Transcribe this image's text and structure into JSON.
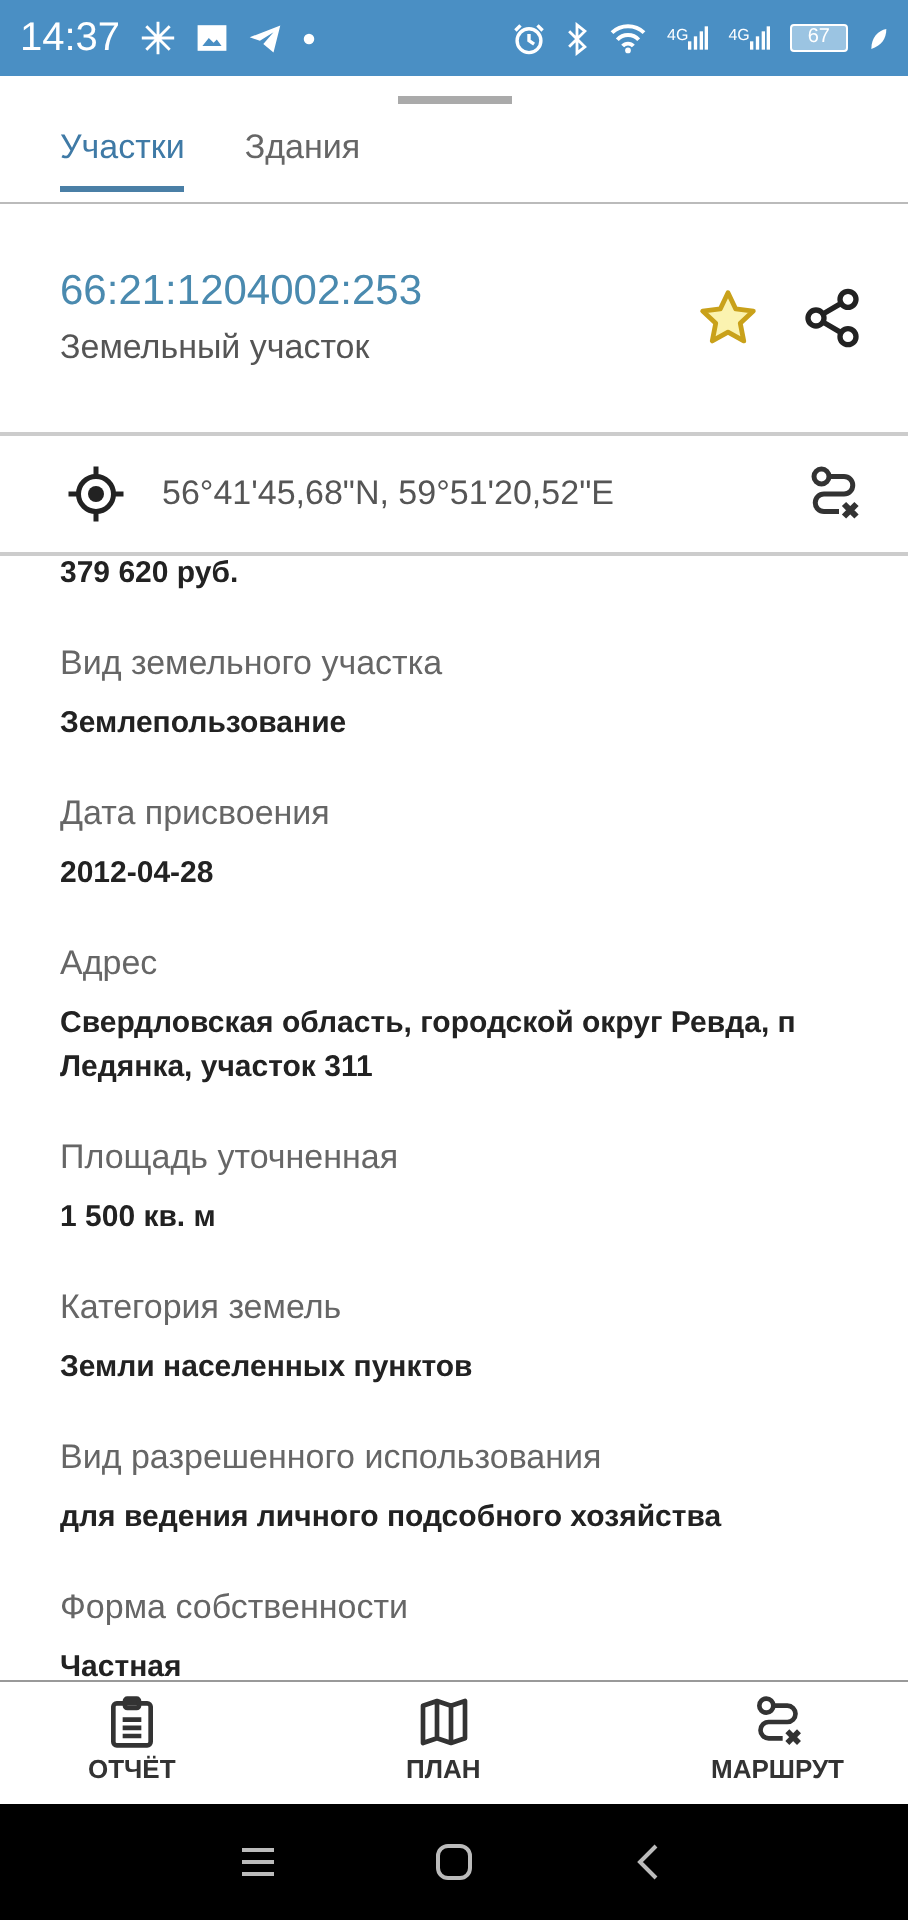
{
  "status_bar": {
    "time": "14:37",
    "network": [
      "4G",
      "4G"
    ],
    "battery": "67"
  },
  "tabs": [
    {
      "label": "Участки",
      "selected": true
    },
    {
      "label": "Здания",
      "selected": false
    }
  ],
  "parcel": {
    "number": "66:21:1204002:253",
    "type": "Земельный участок",
    "favorite": true
  },
  "location": {
    "coordinates": "56°41'45,68\"N, 59°51'20,52\"E"
  },
  "fields": [
    {
      "value": "379 620 руб."
    },
    {
      "label": "Вид земельного участка",
      "value": "Землепользование"
    },
    {
      "label": "Дата присвоения",
      "value": "2012-04-28"
    },
    {
      "label": "Адрес",
      "value": "Свердловская область, городской округ Ревда, п Ледянка, участок 311"
    },
    {
      "label": "Площадь уточненная",
      "value": "1 500 кв. м"
    },
    {
      "label": "Категория земель",
      "value": "Земли населенных пунктов"
    },
    {
      "label": "Вид разрешенного использования",
      "value": "для ведения личного подсобного хозяйства"
    },
    {
      "label": "Форма собственности",
      "value": "Частная"
    }
  ],
  "bottom_nav": [
    {
      "kind": "report",
      "label": "ОТЧЁТ"
    },
    {
      "kind": "plan",
      "label": "ПЛАН"
    },
    {
      "kind": "route",
      "label": "МАРШРУТ"
    }
  ]
}
